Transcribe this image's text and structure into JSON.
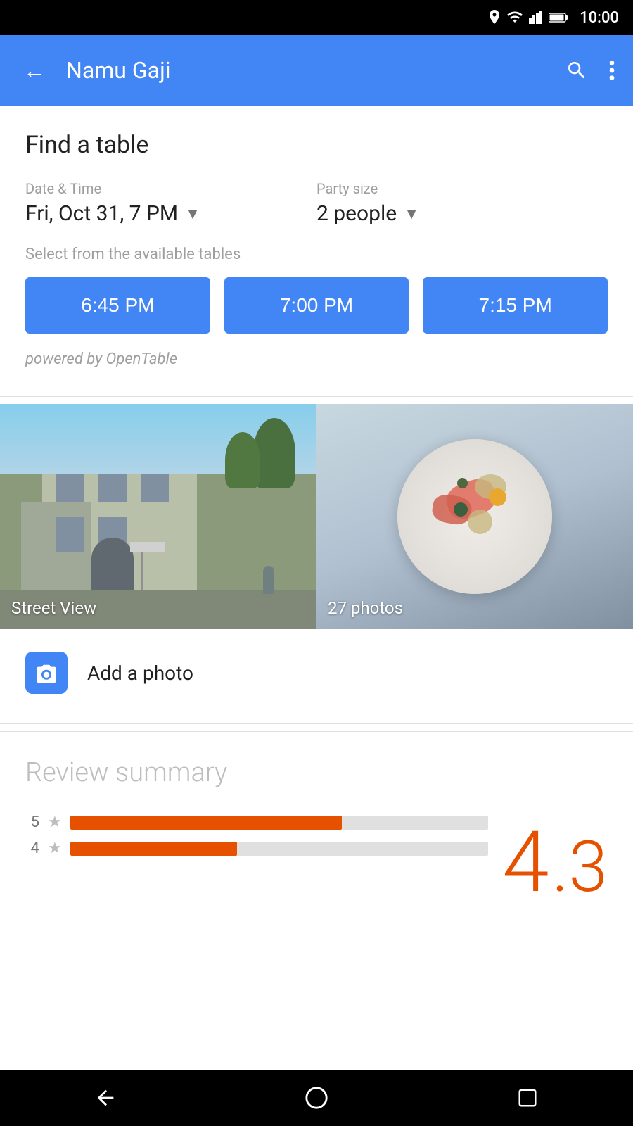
{
  "statusBar": {
    "time": "10:00",
    "icons": [
      "location",
      "wifi",
      "signal",
      "battery"
    ]
  },
  "appBar": {
    "backLabel": "←",
    "title": "Namu Gaji",
    "searchIcon": "🔍",
    "moreIcon": "⋮"
  },
  "findTable": {
    "title": "Find a table",
    "dateLabel": "Date & Time",
    "dateValue": "Fri, Oct 31, 7 PM",
    "partySizeLabel": "Party size",
    "partySizeValue": "2 people",
    "availableLabel": "Select from the available tables",
    "times": [
      "6:45 PM",
      "7:00 PM",
      "7:15 PM"
    ],
    "powerBy": "powered by OpenTable"
  },
  "photos": {
    "streetViewLabel": "Street View",
    "photosLabel": "27 photos"
  },
  "addPhoto": {
    "label": "Add a photo"
  },
  "reviewSummary": {
    "title": "Review summary",
    "bigRatingWhole": "4",
    "bigRatingDecimal": ".3",
    "bars": [
      {
        "star": "5",
        "widthPct": 65
      },
      {
        "star": "4",
        "widthPct": 40
      }
    ]
  },
  "bottomNav": {
    "backSymbol": "◁",
    "homeSymbol": "○",
    "recentSymbol": "□"
  }
}
